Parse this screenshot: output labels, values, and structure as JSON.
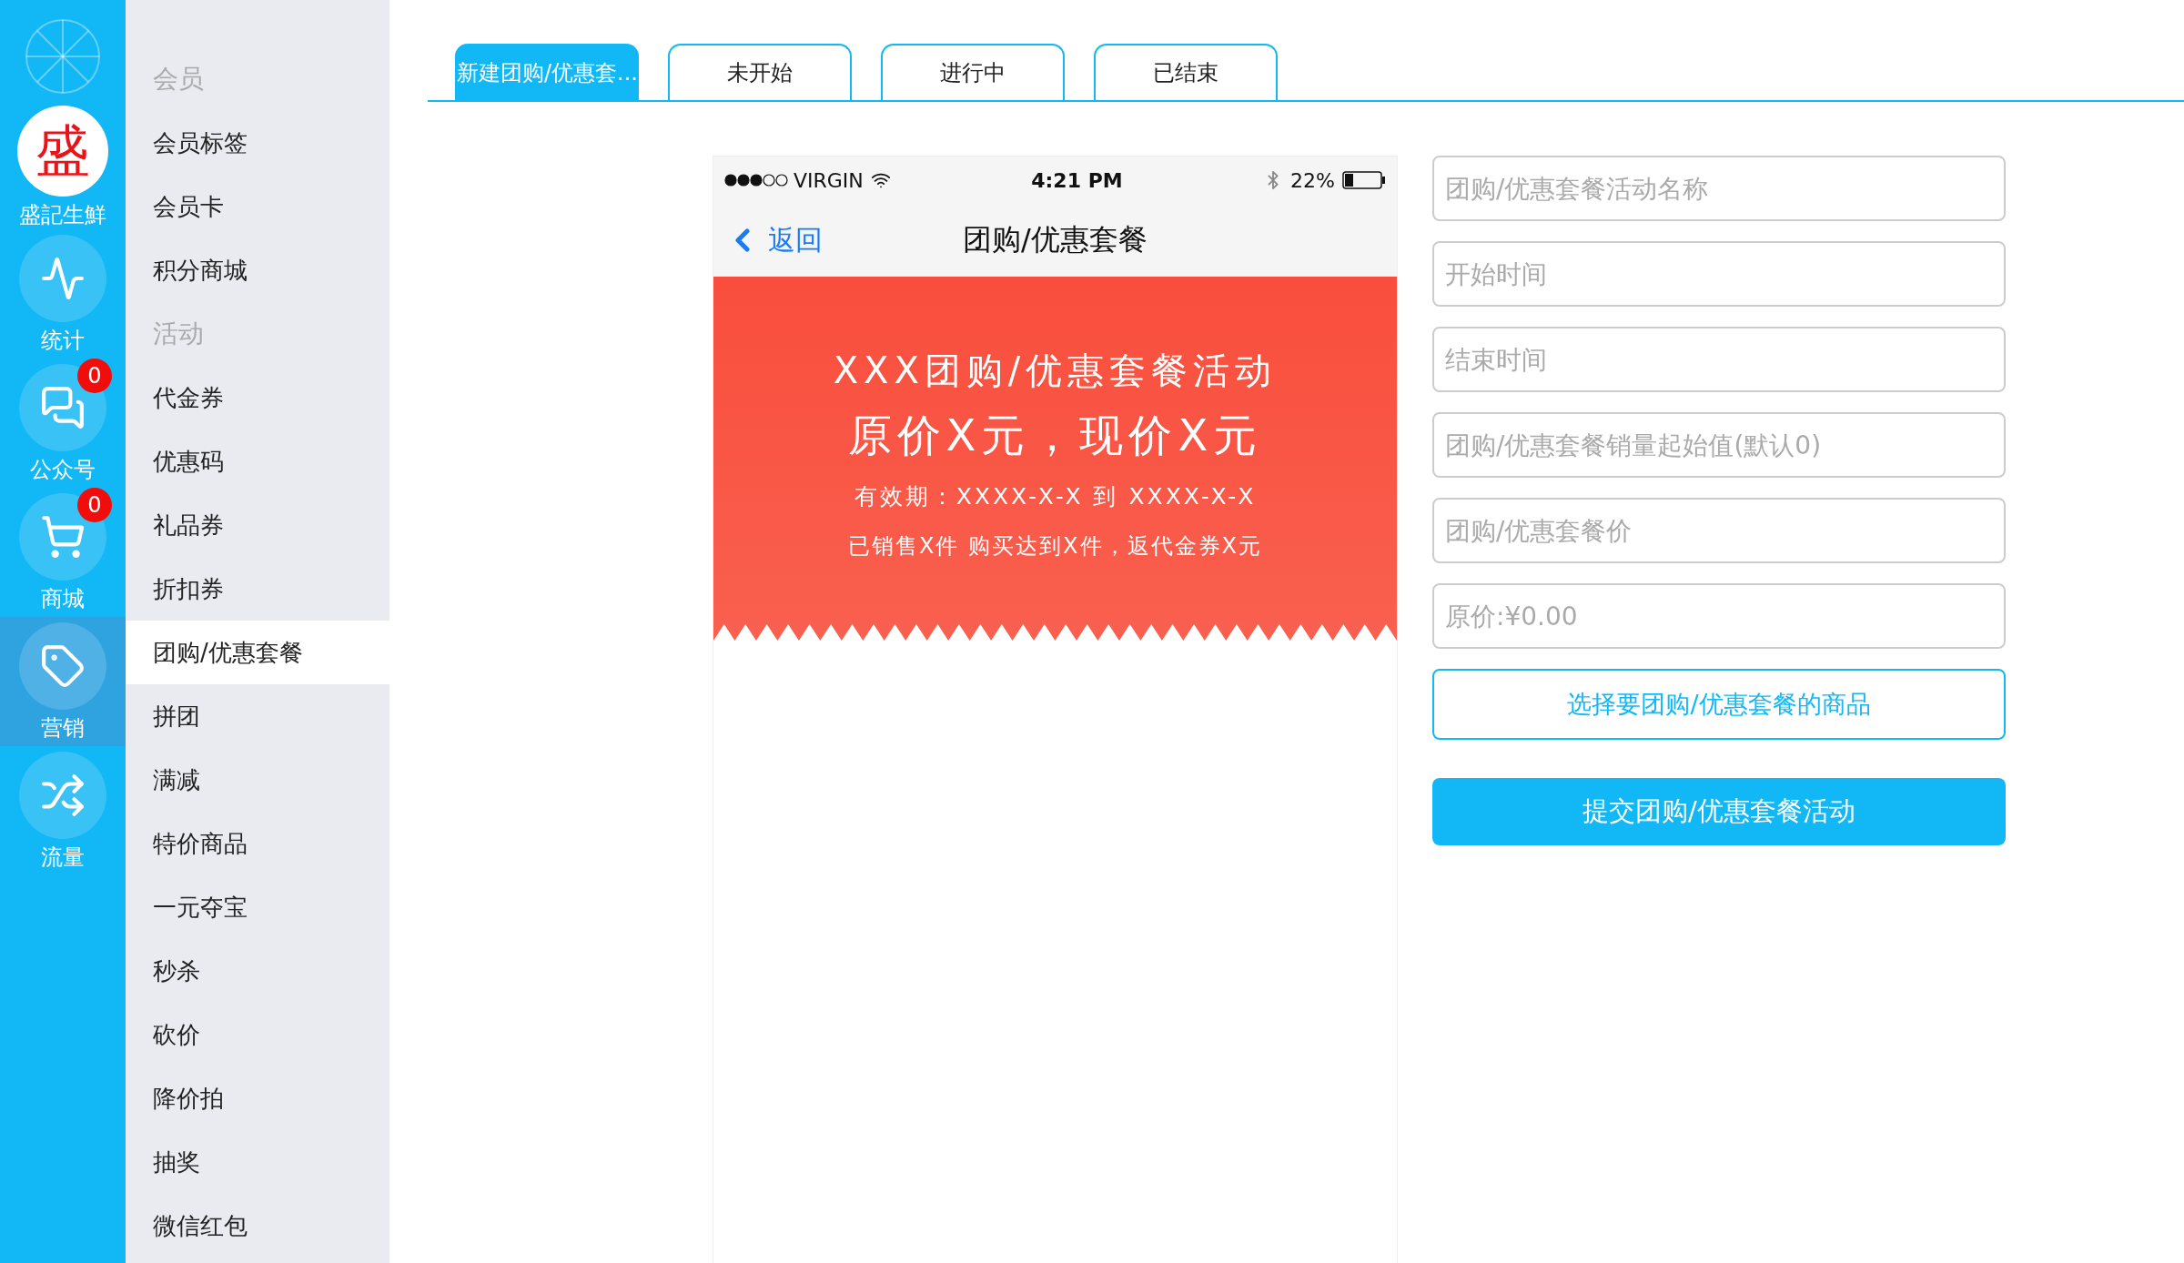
{
  "rail": {
    "items": [
      {
        "kind": "avatar",
        "avatar_text": "盛",
        "label": "盛記生鮮",
        "selected": false
      },
      {
        "kind": "icon",
        "label": "统计",
        "selected": false
      },
      {
        "kind": "icon",
        "label": "公众号",
        "badge": "0",
        "selected": false
      },
      {
        "kind": "icon",
        "label": "商城",
        "badge": "0",
        "selected": false
      },
      {
        "kind": "icon",
        "label": "营销",
        "selected": true
      },
      {
        "kind": "icon",
        "label": "流量",
        "selected": false
      }
    ]
  },
  "submenu": [
    {
      "heading": "会员",
      "items": [
        {
          "label": "会员标签",
          "selected": false
        },
        {
          "label": "会员卡",
          "selected": false
        },
        {
          "label": "积分商城",
          "selected": false
        }
      ]
    },
    {
      "heading": "活动",
      "items": [
        {
          "label": "代金券",
          "selected": false
        },
        {
          "label": "优惠码",
          "selected": false
        },
        {
          "label": "礼品券",
          "selected": false
        },
        {
          "label": "折扣券",
          "selected": false
        },
        {
          "label": "团购/优惠套餐",
          "selected": true
        },
        {
          "label": "拼团",
          "selected": false
        },
        {
          "label": "满减",
          "selected": false
        },
        {
          "label": "特价商品",
          "selected": false
        },
        {
          "label": "一元夺宝",
          "selected": false
        },
        {
          "label": "秒杀",
          "selected": false
        },
        {
          "label": "砍价",
          "selected": false
        },
        {
          "label": "降价拍",
          "selected": false
        },
        {
          "label": "抽奖",
          "selected": false
        },
        {
          "label": "微信红包",
          "selected": false
        }
      ]
    }
  ],
  "tabs": [
    {
      "label": "新建团购/优惠套...",
      "selected": true
    },
    {
      "label": "未开始",
      "selected": false
    },
    {
      "label": "进行中",
      "selected": false
    },
    {
      "label": "已结束",
      "selected": false
    }
  ],
  "phone": {
    "status_bar": {
      "carrier": "VIRGIN",
      "time": "4:21 PM",
      "battery": "22%"
    },
    "nav_bar": {
      "back": "返回",
      "title": "团购/优惠套餐"
    },
    "banner": [
      "XXX团购/优惠套餐活动",
      "原价X元，现价X元",
      "有效期：XXXX-X-X 到 XXXX-X-X",
      "已销售X件 购买达到X件，返代金券X元"
    ]
  },
  "form": {
    "fields": [
      {
        "placeholder": "团购/优惠套餐活动名称"
      },
      {
        "placeholder": "开始时间"
      },
      {
        "placeholder": "结束时间"
      },
      {
        "placeholder": "团购/优惠套餐销量起始值(默认0)"
      },
      {
        "placeholder": "团购/优惠套餐价"
      },
      {
        "placeholder": "原价:¥0.00"
      }
    ],
    "select_button": "选择要团购/优惠套餐的商品",
    "submit_button": "提交团购/优惠套餐活动"
  }
}
